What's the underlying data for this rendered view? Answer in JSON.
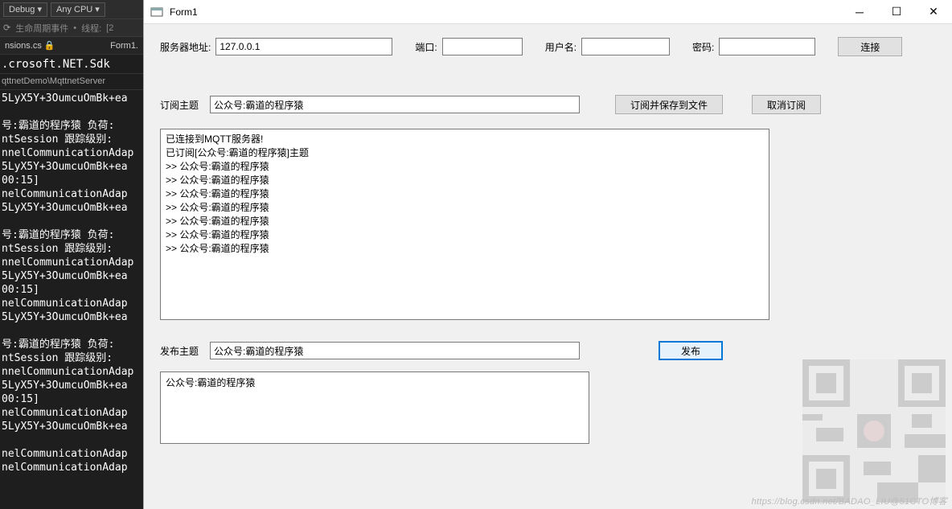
{
  "vs": {
    "debug_dropdown": "Debug",
    "anycpu_dropdown": "Any CPU",
    "lifecycle_label": "生命周期事件",
    "thread_label": "线程:",
    "thread_bracket": "[2",
    "file_left": "nsions.cs",
    "file_right": "Form1.",
    "code_line": ".crosoft.NET.Sdk",
    "path_line": "qttnetDemo\\MqttnetServer",
    "log": "5LyX5Y+3OumcuOmBk+ea\n\n号:霸道的程序猿 负荷:\nntSession 跟踪级别:\nnnelCommunicationAdap\n5LyX5Y+3OumcuOmBk+ea\n00:15]\nnelCommunicationAdap\n5LyX5Y+3OumcuOmBk+ea\n\n号:霸道的程序猿 负荷:\nntSession 跟踪级别:\nnnelCommunicationAdap\n5LyX5Y+3OumcuOmBk+ea\n00:15]\nnelCommunicationAdap\n5LyX5Y+3OumcuOmBk+ea\n\n号:霸道的程序猿 负荷:\nntSession 跟踪级别:\nnnelCommunicationAdap\n5LyX5Y+3OumcuOmBk+ea\n00:15]\nnelCommunicationAdap\n5LyX5Y+3OumcuOmBk+ea\n\nnelCommunicationAdap\nnelCommunicationAdap"
  },
  "form": {
    "title": "Form1",
    "connect_row": {
      "server_label": "服务器地址:",
      "server_value": "127.0.0.1",
      "port_label": "端口:",
      "port_value": "",
      "user_label": "用户名:",
      "user_value": "",
      "pwd_label": "密码:",
      "pwd_value": "",
      "connect_btn": "连接"
    },
    "subscribe_row": {
      "label": "订阅主题",
      "topic_value": "公众号:霸道的程序猿",
      "subscribe_btn": "订阅并保存到文件",
      "unsubscribe_btn": "取消订阅"
    },
    "log_text": "已连接到MQTT服务器!\n已订阅[公众号:霸道的程序猿]主题\n>> 公众号:霸道的程序猿\n>> 公众号:霸道的程序猿\n>> 公众号:霸道的程序猿\n>> 公众号:霸道的程序猿\n>> 公众号:霸道的程序猿\n>> 公众号:霸道的程序猿\n>> 公众号:霸道的程序猿",
    "publish_row": {
      "label": "发布主题",
      "topic_value": "公众号:霸道的程序猿",
      "publish_btn": "发布"
    },
    "message_value": "公众号:霸道的程序猿",
    "watermark": "https://blog.csdn.net/BADAO_LIU@51CTO博客"
  }
}
